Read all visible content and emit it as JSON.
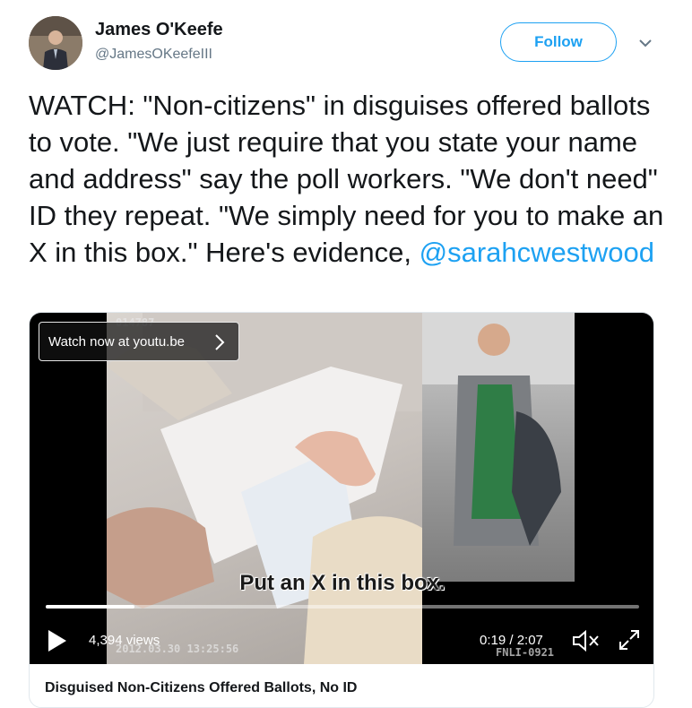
{
  "author": {
    "display_name": "James O'Keefe",
    "handle": "@JamesOKeefeIII",
    "avatar_icon": "avatar-photo"
  },
  "follow_label": "Follow",
  "tweet": {
    "text": "WATCH: \"Non-citizens\" in disguises offered ballots to vote. \"We just require that you state your name and address\" say the poll workers. \"We don't need\" ID they repeat. \"We simply need for you to make an X in this box.\" Here's evidence, ",
    "mention": "@sarahcwestwood"
  },
  "video": {
    "watch_now_label": "Watch now at youtu.be",
    "subtitle": "Put an X in this box.",
    "views": "4,394 views",
    "time": "0:19 / 2:07",
    "progress": 0.15,
    "frame_counter": "014787",
    "date_stamp": "2012.03.30  13:25:56",
    "camera_id": "FNLI-0921"
  },
  "card_title": "Disguised Non-Citizens Offered Ballots, No ID",
  "colors": {
    "accent": "#1da1f2",
    "text": "#14171a",
    "muted": "#657786"
  }
}
